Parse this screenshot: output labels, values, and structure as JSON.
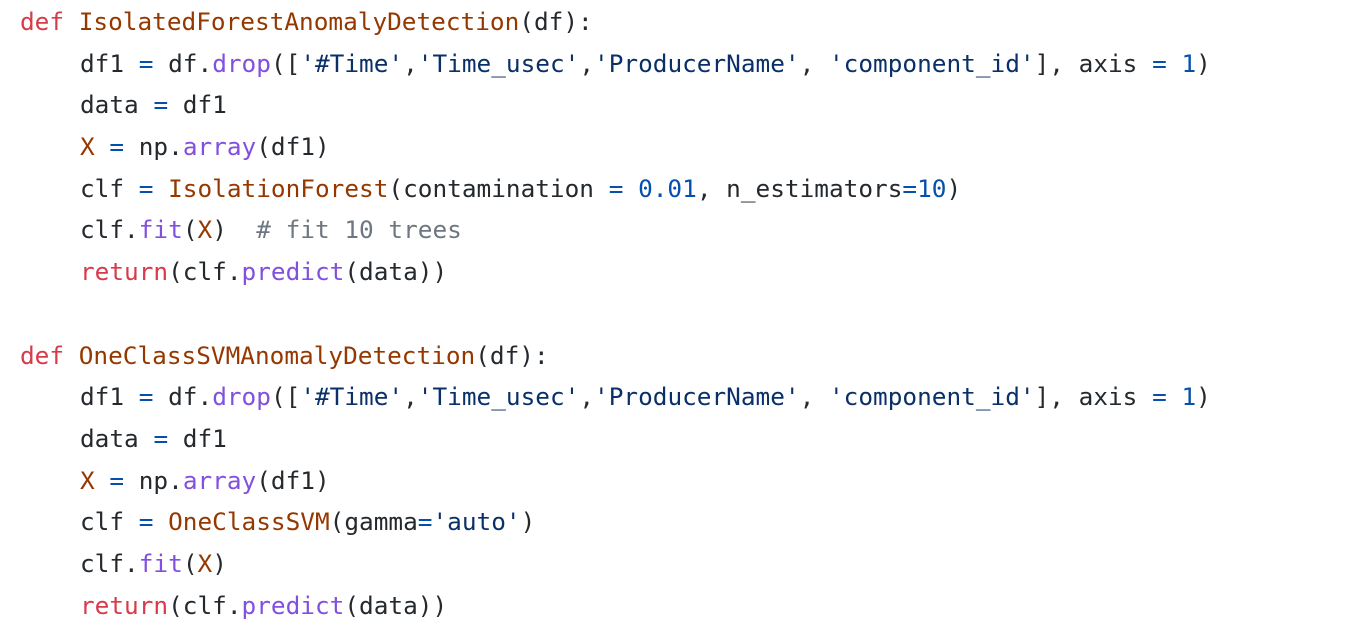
{
  "colors": {
    "background": "#ffffff",
    "plain": "#24292e",
    "keyword": "#d73a49",
    "name": "#953800",
    "method": "#8250df",
    "string": "#0a3069",
    "number": "#0550ae",
    "comment": "#6e7781"
  },
  "lines": [
    {
      "indent": false,
      "tokens": [
        {
          "t": "keyword",
          "v": "def"
        },
        {
          "t": "plain",
          "v": " "
        },
        {
          "t": "funcname",
          "v": "IsolatedForestAnomalyDetection"
        },
        {
          "t": "plain",
          "v": "(df):"
        }
      ]
    },
    {
      "indent": true,
      "tokens": [
        {
          "t": "plain",
          "v": "df1 "
        },
        {
          "t": "operator",
          "v": "="
        },
        {
          "t": "plain",
          "v": " df."
        },
        {
          "t": "method",
          "v": "drop"
        },
        {
          "t": "plain",
          "v": "(["
        },
        {
          "t": "string",
          "v": "'#Time'"
        },
        {
          "t": "plain",
          "v": ","
        },
        {
          "t": "string",
          "v": "'Time_usec'"
        },
        {
          "t": "plain",
          "v": ","
        },
        {
          "t": "string",
          "v": "'ProducerName'"
        },
        {
          "t": "plain",
          "v": ", "
        },
        {
          "t": "string",
          "v": "'component_id'"
        },
        {
          "t": "plain",
          "v": "], axis "
        },
        {
          "t": "operator",
          "v": "="
        },
        {
          "t": "plain",
          "v": " "
        },
        {
          "t": "number",
          "v": "1"
        },
        {
          "t": "plain",
          "v": ")"
        }
      ]
    },
    {
      "indent": true,
      "tokens": [
        {
          "t": "plain",
          "v": "data "
        },
        {
          "t": "operator",
          "v": "="
        },
        {
          "t": "plain",
          "v": " df1"
        }
      ]
    },
    {
      "indent": true,
      "tokens": [
        {
          "t": "var",
          "v": "X"
        },
        {
          "t": "plain",
          "v": " "
        },
        {
          "t": "operator",
          "v": "="
        },
        {
          "t": "plain",
          "v": " np."
        },
        {
          "t": "method",
          "v": "array"
        },
        {
          "t": "plain",
          "v": "(df1)"
        }
      ]
    },
    {
      "indent": true,
      "tokens": [
        {
          "t": "plain",
          "v": "clf "
        },
        {
          "t": "operator",
          "v": "="
        },
        {
          "t": "plain",
          "v": " "
        },
        {
          "t": "class",
          "v": "IsolationForest"
        },
        {
          "t": "plain",
          "v": "(contamination "
        },
        {
          "t": "operator",
          "v": "="
        },
        {
          "t": "plain",
          "v": " "
        },
        {
          "t": "number",
          "v": "0.01"
        },
        {
          "t": "plain",
          "v": ", n_estimators"
        },
        {
          "t": "operator",
          "v": "="
        },
        {
          "t": "number",
          "v": "10"
        },
        {
          "t": "plain",
          "v": ")"
        }
      ]
    },
    {
      "indent": true,
      "tokens": [
        {
          "t": "plain",
          "v": "clf."
        },
        {
          "t": "method",
          "v": "fit"
        },
        {
          "t": "plain",
          "v": "("
        },
        {
          "t": "var",
          "v": "X"
        },
        {
          "t": "plain",
          "v": ")  "
        },
        {
          "t": "comment",
          "v": "# fit 10 trees"
        }
      ]
    },
    {
      "indent": true,
      "tokens": [
        {
          "t": "keyword",
          "v": "return"
        },
        {
          "t": "plain",
          "v": "(clf."
        },
        {
          "t": "method",
          "v": "predict"
        },
        {
          "t": "plain",
          "v": "(data))"
        }
      ]
    },
    {
      "indent": false,
      "tokens": []
    },
    {
      "indent": false,
      "tokens": [
        {
          "t": "keyword",
          "v": "def"
        },
        {
          "t": "plain",
          "v": " "
        },
        {
          "t": "funcname",
          "v": "OneClassSVMAnomalyDetection"
        },
        {
          "t": "plain",
          "v": "(df):"
        }
      ]
    },
    {
      "indent": true,
      "tokens": [
        {
          "t": "plain",
          "v": "df1 "
        },
        {
          "t": "operator",
          "v": "="
        },
        {
          "t": "plain",
          "v": " df."
        },
        {
          "t": "method",
          "v": "drop"
        },
        {
          "t": "plain",
          "v": "(["
        },
        {
          "t": "string",
          "v": "'#Time'"
        },
        {
          "t": "plain",
          "v": ","
        },
        {
          "t": "string",
          "v": "'Time_usec'"
        },
        {
          "t": "plain",
          "v": ","
        },
        {
          "t": "string",
          "v": "'ProducerName'"
        },
        {
          "t": "plain",
          "v": ", "
        },
        {
          "t": "string",
          "v": "'component_id'"
        },
        {
          "t": "plain",
          "v": "], axis "
        },
        {
          "t": "operator",
          "v": "="
        },
        {
          "t": "plain",
          "v": " "
        },
        {
          "t": "number",
          "v": "1"
        },
        {
          "t": "plain",
          "v": ")"
        }
      ]
    },
    {
      "indent": true,
      "tokens": [
        {
          "t": "plain",
          "v": "data "
        },
        {
          "t": "operator",
          "v": "="
        },
        {
          "t": "plain",
          "v": " df1"
        }
      ]
    },
    {
      "indent": true,
      "tokens": [
        {
          "t": "var",
          "v": "X"
        },
        {
          "t": "plain",
          "v": " "
        },
        {
          "t": "operator",
          "v": "="
        },
        {
          "t": "plain",
          "v": " np."
        },
        {
          "t": "method",
          "v": "array"
        },
        {
          "t": "plain",
          "v": "(df1)"
        }
      ]
    },
    {
      "indent": true,
      "tokens": [
        {
          "t": "plain",
          "v": "clf "
        },
        {
          "t": "operator",
          "v": "="
        },
        {
          "t": "plain",
          "v": " "
        },
        {
          "t": "class",
          "v": "OneClassSVM"
        },
        {
          "t": "plain",
          "v": "(gamma"
        },
        {
          "t": "operator",
          "v": "="
        },
        {
          "t": "string",
          "v": "'auto'"
        },
        {
          "t": "plain",
          "v": ")"
        }
      ]
    },
    {
      "indent": true,
      "tokens": [
        {
          "t": "plain",
          "v": "clf."
        },
        {
          "t": "method",
          "v": "fit"
        },
        {
          "t": "plain",
          "v": "("
        },
        {
          "t": "var",
          "v": "X"
        },
        {
          "t": "plain",
          "v": ")"
        }
      ]
    },
    {
      "indent": true,
      "tokens": [
        {
          "t": "keyword",
          "v": "return"
        },
        {
          "t": "plain",
          "v": "(clf."
        },
        {
          "t": "method",
          "v": "predict"
        },
        {
          "t": "plain",
          "v": "(data))"
        }
      ]
    }
  ]
}
